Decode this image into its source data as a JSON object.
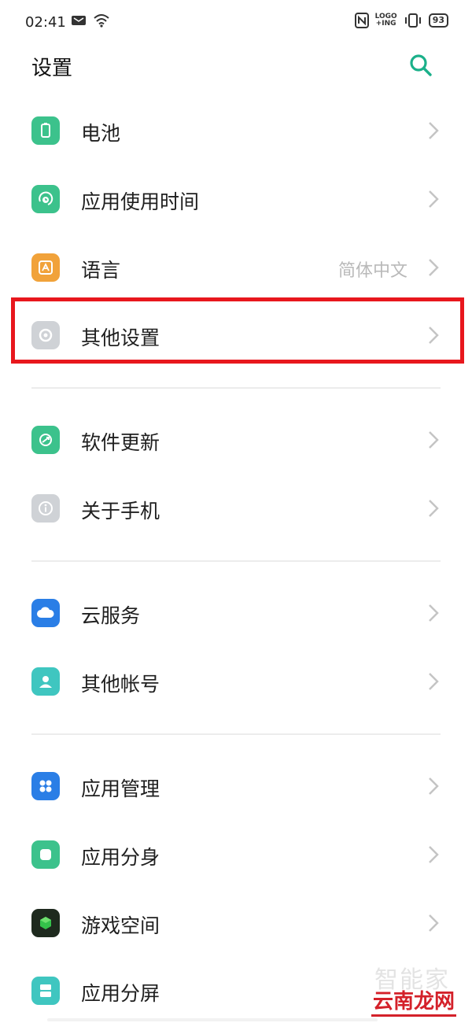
{
  "status_bar": {
    "time": "02:41",
    "hd_top": "LOGO",
    "hd_bottom": "+ING",
    "battery": "93"
  },
  "header": {
    "title": "设置"
  },
  "colors": {
    "accent": "#1bb08a",
    "highlight_border": "#e8171d",
    "icon_green": "#3cc28c",
    "icon_orange": "#f1a23a",
    "icon_gray": "#cfd2d6",
    "icon_blue": "#2a7ee6",
    "icon_teal": "#3fc6c0",
    "icon_dark_green": "#1e2a1e"
  },
  "settings": {
    "battery": {
      "label": "电池",
      "icon": "battery-icon"
    },
    "app_usage": {
      "label": "应用使用时间",
      "icon": "app-usage-icon"
    },
    "language": {
      "label": "语言",
      "value": "简体中文",
      "icon": "language-icon"
    },
    "other_settings": {
      "label": "其他设置",
      "icon": "other-settings-icon"
    },
    "software_update": {
      "label": "软件更新",
      "icon": "software-update-icon"
    },
    "about_phone": {
      "label": "关于手机",
      "icon": "info-icon"
    },
    "cloud_service": {
      "label": "云服务",
      "icon": "cloud-icon"
    },
    "other_accounts": {
      "label": "其他帐号",
      "icon": "account-icon"
    },
    "app_management": {
      "label": "应用管理",
      "icon": "app-management-icon"
    },
    "app_clone": {
      "label": "应用分身",
      "icon": "app-clone-icon"
    },
    "game_space": {
      "label": "游戏空间",
      "icon": "game-space-icon"
    },
    "split_screen": {
      "label": "应用分屏",
      "icon": "split-screen-icon"
    }
  },
  "watermark": {
    "top": "智能家",
    "bottom": "云南龙网"
  }
}
